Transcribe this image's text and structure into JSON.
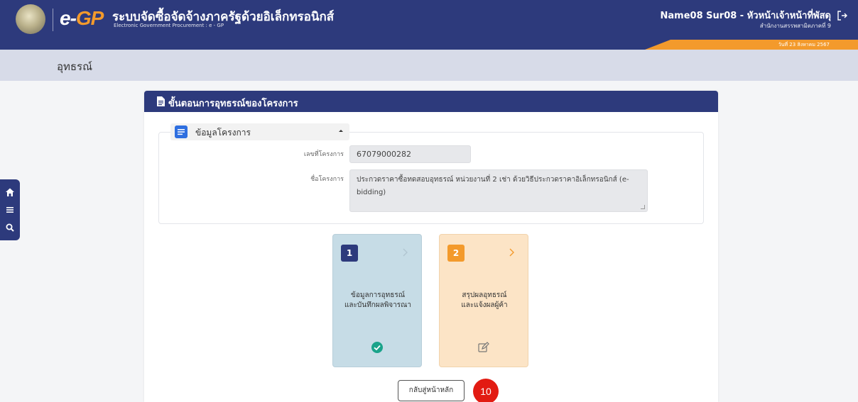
{
  "header": {
    "brand_e": "e-",
    "brand_gp": "GP",
    "system_title": "ระบบจัดซื้อจัดจ้างภาครัฐด้วยอิเล็กทรอนิกส์",
    "system_subtitle": "Electronic Government Procurement : e - GP",
    "user_name": "Name08 Sur08 - หัวหน้าเจ้าหน้าที่พัสดุ",
    "user_org": "สำนักงานสรรพสามิตภาคที่ 9",
    "date": "วันที่ 23 สิงหาคม 2567"
  },
  "page": {
    "title": "อุทธรณ์"
  },
  "panel": {
    "title": "ขั้นตอนการอุทธรณ์ของโครงการ",
    "section_label": "ข้อมูลโครงการ",
    "fields": {
      "project_no_label": "เลขที่โครงการ",
      "project_no_value": "67079000282",
      "project_name_label": "ชื่อโครงการ",
      "project_name_value": "ประกวดราคาซื้อทดสอบอุทธรณ์ หน่วยงานที่ 2 เช่า ด้วยวิธีประกวดราคาอิเล็กทรอนิกส์ (e-bidding)"
    },
    "steps": [
      {
        "num": "1",
        "caption_line1": "ข้อมูลการอุทธรณ์",
        "caption_line2": "และบันทึกผลพิจารณา",
        "status_icon": "check-circle-icon"
      },
      {
        "num": "2",
        "caption_line1": "สรุปผลอุทธรณ์",
        "caption_line2": "และแจ้งผลผู้ค้า",
        "status_icon": "edit-icon"
      }
    ],
    "back_button": "กลับสู่หน้าหลัก"
  },
  "annotation_badge": "10",
  "colors": {
    "navy": "#2d3a7c",
    "orange": "#f39a2c",
    "step1_bg": "#c6dce6",
    "step2_bg": "#fce4c6",
    "check_green": "#1aa38a",
    "badge_red": "#e21b12"
  }
}
